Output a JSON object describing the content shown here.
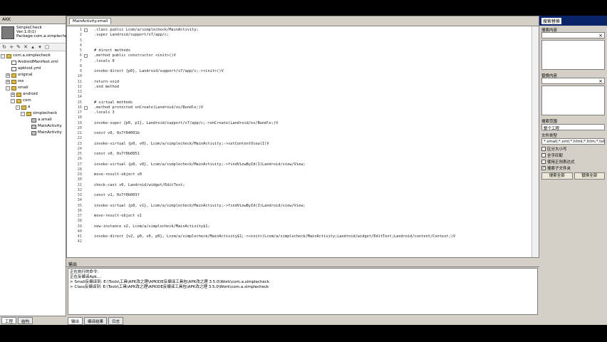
{
  "left": {
    "title": "AKK",
    "app_name": "SimpleCheck",
    "app_version": "Ver:1.0(1)",
    "app_package": "Package:com.a.simplecheck",
    "tree": [
      {
        "label": "com.a.simplecheck",
        "depth": 0,
        "icon": "folder",
        "exp": "-"
      },
      {
        "label": "AndroidManifest.xml",
        "depth": 1,
        "icon": "file",
        "exp": ""
      },
      {
        "label": "apktool.yml",
        "depth": 1,
        "icon": "file",
        "exp": ""
      },
      {
        "label": "original",
        "depth": 1,
        "icon": "folder",
        "exp": "+"
      },
      {
        "label": "res",
        "depth": 1,
        "icon": "folder",
        "exp": "+"
      },
      {
        "label": "smali",
        "depth": 1,
        "icon": "folder",
        "exp": "-"
      },
      {
        "label": "android",
        "depth": 2,
        "icon": "folder",
        "exp": "+"
      },
      {
        "label": "com",
        "depth": 2,
        "icon": "folder",
        "exp": "-"
      },
      {
        "label": "a",
        "depth": 3,
        "icon": "folder",
        "exp": "-"
      },
      {
        "label": "simplecheck",
        "depth": 4,
        "icon": "folder",
        "exp": "-"
      },
      {
        "label": "a.smali",
        "depth": 5,
        "icon": "cls",
        "exp": ""
      },
      {
        "label": "MainActivity",
        "depth": 5,
        "icon": "cls",
        "exp": ""
      },
      {
        "label": "MainActivity",
        "depth": 5,
        "icon": "cls",
        "exp": ""
      }
    ],
    "bottom_tabs": [
      "工程",
      "结构"
    ]
  },
  "editor": {
    "tab_label": "MainActivity.smali",
    "lines": [
      {
        "n": "1",
        "t": ".class public Lcom/a/simplecheck/MainActivity;",
        "fold": true
      },
      {
        "n": "2",
        "t": ".super Landroid/support/v7/app/c;",
        "fold": false
      },
      {
        "n": "3",
        "t": "",
        "fold": false
      },
      {
        "n": "4",
        "t": "",
        "fold": false
      },
      {
        "n": "5",
        "t": "# direct methods",
        "fold": false
      },
      {
        "n": "6",
        "t": ".method public constructor <init>()V",
        "fold": true
      },
      {
        "n": "7",
        "t": "    .locals 0",
        "fold": false
      },
      {
        "n": "8",
        "t": "",
        "fold": false
      },
      {
        "n": "9",
        "t": "    invoke-direct {p0}, Landroid/support/v7/app/c;-><init>()V",
        "fold": false
      },
      {
        "n": "10",
        "t": "",
        "fold": false
      },
      {
        "n": "11",
        "t": "    return-void",
        "fold": false
      },
      {
        "n": "12",
        "t": ".end method",
        "fold": false
      },
      {
        "n": "13",
        "t": "",
        "fold": false
      },
      {
        "n": "14",
        "t": "",
        "fold": false
      },
      {
        "n": "15",
        "t": "# virtual methods",
        "fold": false
      },
      {
        "n": "16",
        "t": ".method protected onCreate(Landroid/os/Bundle;)V",
        "fold": true
      },
      {
        "n": "17",
        "t": "    .locals 3",
        "fold": false
      },
      {
        "n": "18",
        "t": "",
        "fold": false
      },
      {
        "n": "19",
        "t": "    invoke-super {p0, p1}, Landroid/support/v7/app/c;->onCreate(Landroid/os/Bundle;)V",
        "fold": false
      },
      {
        "n": "20",
        "t": "",
        "fold": false
      },
      {
        "n": "21",
        "t": "    const v0, 0x7f04001b",
        "fold": false
      },
      {
        "n": "22",
        "t": "",
        "fold": false
      },
      {
        "n": "23",
        "t": "    invoke-virtual {p0, v0}, Lcom/a/simplecheck/MainActivity;->setContentView(I)V",
        "fold": false
      },
      {
        "n": "24",
        "t": "",
        "fold": false
      },
      {
        "n": "25",
        "t": "    const v0, 0x7f0b0051",
        "fold": false
      },
      {
        "n": "26",
        "t": "",
        "fold": false
      },
      {
        "n": "27",
        "t": "    invoke-virtual {p0, v0}, Lcom/a/simplecheck/MainActivity;->findViewById(I)Landroid/view/View;",
        "fold": false
      },
      {
        "n": "28",
        "t": "",
        "fold": false
      },
      {
        "n": "29",
        "t": "    move-result-object v0",
        "fold": false
      },
      {
        "n": "30",
        "t": "",
        "fold": false
      },
      {
        "n": "31",
        "t": "    check-cast v0, Landroid/widget/EditText;",
        "fold": false
      },
      {
        "n": "32",
        "t": "",
        "fold": false
      },
      {
        "n": "33",
        "t": "    const v1, 0x7f0b003f",
        "fold": false
      },
      {
        "n": "34",
        "t": "",
        "fold": false
      },
      {
        "n": "35",
        "t": "    invoke-virtual {p0, v1}, Lcom/a/simplecheck/MainActivity;->findViewById(I)Landroid/view/View;",
        "fold": false
      },
      {
        "n": "36",
        "t": "",
        "fold": false
      },
      {
        "n": "37",
        "t": "    move-result-object v1",
        "fold": false
      },
      {
        "n": "38",
        "t": "",
        "fold": false
      },
      {
        "n": "39",
        "t": "    new-instance v2, Lcom/a/simplecheck/MainActivity$1;",
        "fold": false
      },
      {
        "n": "40",
        "t": "",
        "fold": false
      },
      {
        "n": "41",
        "t": "    invoke-direct {v2, p0, v0, p0}, Lcom/a/simplecheck/MainActivity$1;-><init>(Lcom/a/simplecheck/MainActivity;Landroid/widget/EditText;Landroid/content/Context;)V",
        "fold": false
      },
      {
        "n": "42",
        "t": "",
        "fold": false
      }
    ]
  },
  "output": {
    "title": "输出",
    "lines": [
      "正在执行的命令:",
      "正在反编译Apk...",
      "> Smali反编译到: E:\\Tools\\工具\\APK改之理\\APKIDE反编译工具包\\APK改之理 3.5.0\\Work\\com.a.simplecheck",
      "> Class反编译到: E:\\Tools\\工具\\APK改之理\\APKIDE反编译工具包\\APK改之理 3.5.0\\Work\\com.a.simplecheck"
    ],
    "tabs": [
      "输出",
      "编译结果",
      "日志"
    ]
  },
  "search": {
    "title": "搜索替换",
    "find_label": "搜索内容",
    "replace_label": "替换内容",
    "mode_label": "搜索范围",
    "mode_value": "整个工程",
    "filetype_label": "文件类型",
    "filetype_value": "*.smali;*.xml;*.html;*.htm;*.txt",
    "options": [
      {
        "label": "区分大小写",
        "checked": false
      },
      {
        "label": "全字匹配",
        "checked": false
      },
      {
        "label": "使用正则表达式",
        "checked": false
      },
      {
        "label": "搜索子文件夹",
        "checked": true
      }
    ],
    "search_button": "搜索全部",
    "replace_button": "替换全部"
  }
}
